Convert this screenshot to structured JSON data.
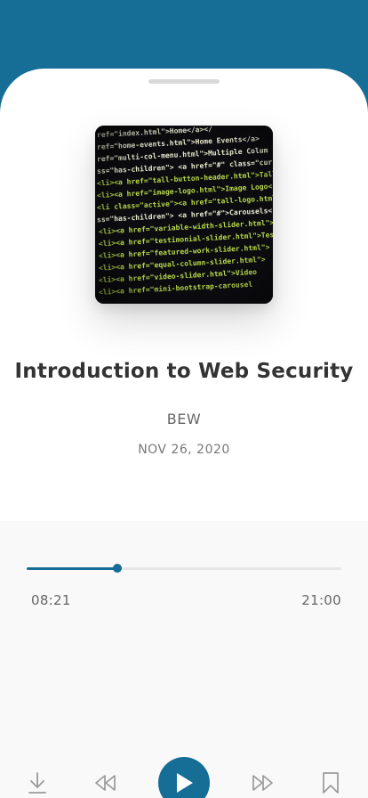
{
  "episode": {
    "title": "Introduction to Web Security",
    "author": "BEW",
    "date": "NOV 26, 2020"
  },
  "artwork": {
    "description_icon": "code-screen-image",
    "code_lines": [
      {
        "text": "ref=\"index.html\">Home</a></",
        "color": "#e9e9d0"
      },
      {
        "text": "ref=\"home-events.html\">Home Events</a>",
        "color": "#e9e9d0"
      },
      {
        "text": "ref=\"multi-col-menu.html\">Multiple Colum",
        "color": "#e9e9d0"
      },
      {
        "text": "ss=\"has-children\"> <a href=\"#\" class=\"current",
        "color": "#e9e9d0"
      },
      {
        "text": "<li><a href=\"tall-button-header.html\">Tall",
        "color": "#b7d84a"
      },
      {
        "text": "<li><a href=\"image-logo.html\">Image Logo</a>",
        "color": "#b7d84a"
      },
      {
        "text": "<li class=\"active\"><a href=\"tall-logo.html\">",
        "color": "#b7d84a"
      },
      {
        "text": "ss=\"has-children\"> <a href=\"#\">Carousels</a>",
        "color": "#e9e9d0"
      },
      {
        "text": "<li><a href=\"variable-width-slider.html\">",
        "color": "#b7d84a"
      },
      {
        "text": "<li><a href=\"testimonial-slider.html\">Test",
        "color": "#b7d84a"
      },
      {
        "text": "<li><a href=\"featured-work-slider.html\">",
        "color": "#b7d84a"
      },
      {
        "text": "<li><a href=\"equal-column-slider.html\">",
        "color": "#b7d84a"
      },
      {
        "text": "<li><a href=\"video-slider.html\">Video",
        "color": "#b7d84a"
      },
      {
        "text": "<li><a href=\"mini-bootstrap-carousel",
        "color": "#b7d84a"
      }
    ]
  },
  "progress": {
    "elapsed": "08:21",
    "total": "21:00",
    "fraction": 0.2882
  },
  "controls": {
    "download_icon": "download-icon",
    "rewind_icon": "rewind-icon",
    "play_icon": "play-icon",
    "forward_icon": "fast-forward-icon",
    "bookmark_icon": "bookmark-icon"
  },
  "colors": {
    "accent": "#166d96",
    "title": "#333333",
    "muted": "#666666",
    "player_bg": "#f9f9f9",
    "icon_gray": "#9a9a9a"
  }
}
